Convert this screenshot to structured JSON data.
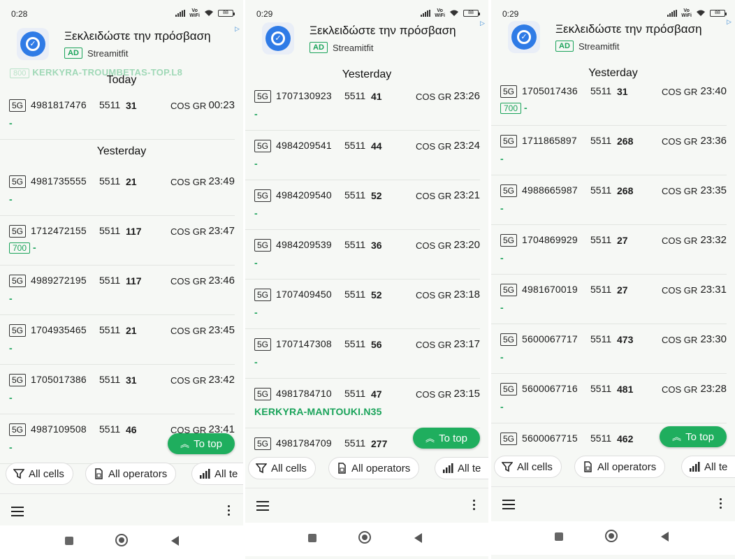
{
  "ad": {
    "title": "Ξεκλειδώστε την πρόσβαση",
    "badge": "AD",
    "advertiser": "Streamitfit"
  },
  "buttons": {
    "to_top": "To top"
  },
  "chips": {
    "all_cells": "All cells",
    "all_operators": "All operators",
    "all_tech": "All te"
  },
  "panels": [
    {
      "time": "0:28",
      "battery": "88",
      "partial_top": {
        "band": "800",
        "site": "KERKYRA-TROUMBETAS-TOP.L8"
      },
      "today_label": "Today",
      "today_rows": [
        {
          "net": "5G",
          "cid": "4981817476",
          "mcc": "5511",
          "pci": "31",
          "op": "COS GR",
          "time": "00:23",
          "band": "",
          "site": "-"
        }
      ],
      "yesterday_label": "Yesterday",
      "rows": [
        {
          "net": "5G",
          "cid": "4981735555",
          "mcc": "5511",
          "pci": "21",
          "op": "COS GR",
          "time": "23:49",
          "band": "",
          "site": "-"
        },
        {
          "net": "5G",
          "cid": "1712472155",
          "mcc": "5511",
          "pci": "117",
          "op": "COS GR",
          "time": "23:47",
          "band": "700",
          "site": "-"
        },
        {
          "net": "5G",
          "cid": "4989272195",
          "mcc": "5511",
          "pci": "117",
          "op": "COS GR",
          "time": "23:46",
          "band": "",
          "site": "-"
        },
        {
          "net": "5G",
          "cid": "1704935465",
          "mcc": "5511",
          "pci": "21",
          "op": "COS GR",
          "time": "23:45",
          "band": "",
          "site": "-"
        },
        {
          "net": "5G",
          "cid": "1705017386",
          "mcc": "5511",
          "pci": "31",
          "op": "COS GR",
          "time": "23:42",
          "band": "",
          "site": "-"
        },
        {
          "net": "5G",
          "cid": "4987109508",
          "mcc": "5511",
          "pci": "46",
          "op": "COS GR",
          "time": "23:41",
          "band": "",
          "site": "-"
        }
      ]
    },
    {
      "time": "0:29",
      "battery": "88",
      "yesterday_label": "Yesterday",
      "rows": [
        {
          "net": "5G",
          "cid": "1707130923",
          "mcc": "5511",
          "pci": "41",
          "op": "COS GR",
          "time": "23:26",
          "band": "",
          "site": "-"
        },
        {
          "net": "5G",
          "cid": "4984209541",
          "mcc": "5511",
          "pci": "44",
          "op": "COS GR",
          "time": "23:24",
          "band": "",
          "site": "-"
        },
        {
          "net": "5G",
          "cid": "4984209540",
          "mcc": "5511",
          "pci": "52",
          "op": "COS GR",
          "time": "23:21",
          "band": "",
          "site": "-"
        },
        {
          "net": "5G",
          "cid": "4984209539",
          "mcc": "5511",
          "pci": "36",
          "op": "COS GR",
          "time": "23:20",
          "band": "",
          "site": "-"
        },
        {
          "net": "5G",
          "cid": "1707409450",
          "mcc": "5511",
          "pci": "52",
          "op": "COS GR",
          "time": "23:18",
          "band": "",
          "site": "-"
        },
        {
          "net": "5G",
          "cid": "1707147308",
          "mcc": "5511",
          "pci": "56",
          "op": "COS GR",
          "time": "23:17",
          "band": "",
          "site": "-"
        },
        {
          "net": "5G",
          "cid": "4981784710",
          "mcc": "5511",
          "pci": "47",
          "op": "COS GR",
          "time": "23:15",
          "band": "",
          "site": "KERKYRA-MANTOUKI.N35"
        },
        {
          "net": "5G",
          "cid": "4981784709",
          "mcc": "5511",
          "pci": "277",
          "op": "",
          "time": "",
          "band": "",
          "site": ""
        }
      ]
    },
    {
      "time": "0:29",
      "battery": "88",
      "yesterday_label": "Yesterday",
      "rows": [
        {
          "net": "5G",
          "cid": "1705017436",
          "mcc": "5511",
          "pci": "31",
          "op": "COS GR",
          "time": "23:40",
          "band": "700",
          "site": "-"
        },
        {
          "net": "5G",
          "cid": "1711865897",
          "mcc": "5511",
          "pci": "268",
          "op": "COS GR",
          "time": "23:36",
          "band": "",
          "site": "-"
        },
        {
          "net": "5G",
          "cid": "4988665987",
          "mcc": "5511",
          "pci": "268",
          "op": "COS GR",
          "time": "23:35",
          "band": "",
          "site": "-"
        },
        {
          "net": "5G",
          "cid": "1704869929",
          "mcc": "5511",
          "pci": "27",
          "op": "COS GR",
          "time": "23:32",
          "band": "",
          "site": "-"
        },
        {
          "net": "5G",
          "cid": "4981670019",
          "mcc": "5511",
          "pci": "27",
          "op": "COS GR",
          "time": "23:31",
          "band": "",
          "site": "-"
        },
        {
          "net": "5G",
          "cid": "5600067717",
          "mcc": "5511",
          "pci": "473",
          "op": "COS GR",
          "time": "23:30",
          "band": "",
          "site": "-"
        },
        {
          "net": "5G",
          "cid": "5600067716",
          "mcc": "5511",
          "pci": "481",
          "op": "COS GR",
          "time": "23:28",
          "band": "",
          "site": "-"
        },
        {
          "net": "5G",
          "cid": "5600067715",
          "mcc": "5511",
          "pci": "462",
          "op": "",
          "time": "",
          "band": "",
          "site": ""
        }
      ]
    }
  ]
}
